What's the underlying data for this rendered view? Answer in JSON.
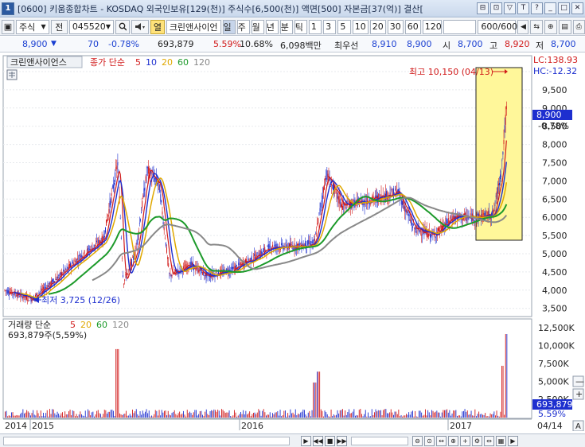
{
  "window": {
    "number": "1",
    "title": "[0600] 키움종합차트 - KOSDAQ 외국인보유[129(천)] 주식수[6,500(천)] 액면[500] 자본금[37(억)] 결산[",
    "buttons": [
      "⊟",
      "⊡",
      "▽",
      "T",
      "?",
      "_",
      "□",
      "✕"
    ]
  },
  "toolbar": {
    "market": "주식",
    "prev_label": "전",
    "code": "045520",
    "search_icon": "magnifier-icon",
    "sound_icon": "speaker-icon",
    "col_label": "열",
    "stock_name": "크린앤사이언",
    "periods": [
      "일",
      "주",
      "월",
      "년",
      "분",
      "틱"
    ],
    "active_period": "일",
    "intervals": [
      "1",
      "3",
      "5",
      "10",
      "20",
      "30",
      "60",
      "120"
    ],
    "count_value": "600",
    "count_total": "/600"
  },
  "quote": {
    "price": "8,900",
    "change": "70",
    "change_pct": "-0.78%",
    "volume": "693,879",
    "volume_pct": "5.59%",
    "turnover": "10.68%",
    "amount": "6,098백만",
    "best_bid_label": "최우선",
    "best_bid": "8,910",
    "best_ask": "8,900",
    "open_label": "시",
    "open": "8,700",
    "high_label": "고",
    "high": "8,920",
    "low_label": "저",
    "low": "8,700"
  },
  "price_panel": {
    "stock_name": "크린앤사이언스",
    "legend_label": "종가 단순",
    "ma_periods": [
      "5",
      "10",
      "20",
      "60",
      "120"
    ],
    "ma_colors": [
      "#d11a1a",
      "#1d2fcf",
      "#e0a800",
      "#1c9a2a",
      "#888888"
    ],
    "lc_label": "LC:138.93",
    "hc_label": "HC:-12.32",
    "high_note": "최고 10,150 (04/13)",
    "low_note": "최저 3,725 (12/26)",
    "price_box": "8,900",
    "price_change_box": "-0.78%",
    "y_axis": [
      "10,000",
      "9,500",
      "9,000",
      "8,500",
      "8,000",
      "7,500",
      "7,000",
      "6,500",
      "6,000",
      "5,500",
      "5,000",
      "4,500",
      "4,000",
      "3,500"
    ]
  },
  "volume_panel": {
    "legend_label": "거래량 단순",
    "ma_periods": [
      "5",
      "20",
      "60",
      "120"
    ],
    "volume_text": "693,879주(5,59%)",
    "y_axis": [
      "12,500K",
      "10,000K",
      "7,500K",
      "5,000K",
      "2,500K"
    ],
    "volume_box": "693,879",
    "volume_pct_box": "5.59%"
  },
  "x_axis": [
    "2014",
    "2015",
    "2016",
    "2017"
  ],
  "x_axis_right": "04/14",
  "right_tools": [
    "—",
    "+",
    "A"
  ],
  "colors": {
    "up": "#d11a1a",
    "down": "#1d2fcf",
    "highlight": "#fff79a"
  }
}
